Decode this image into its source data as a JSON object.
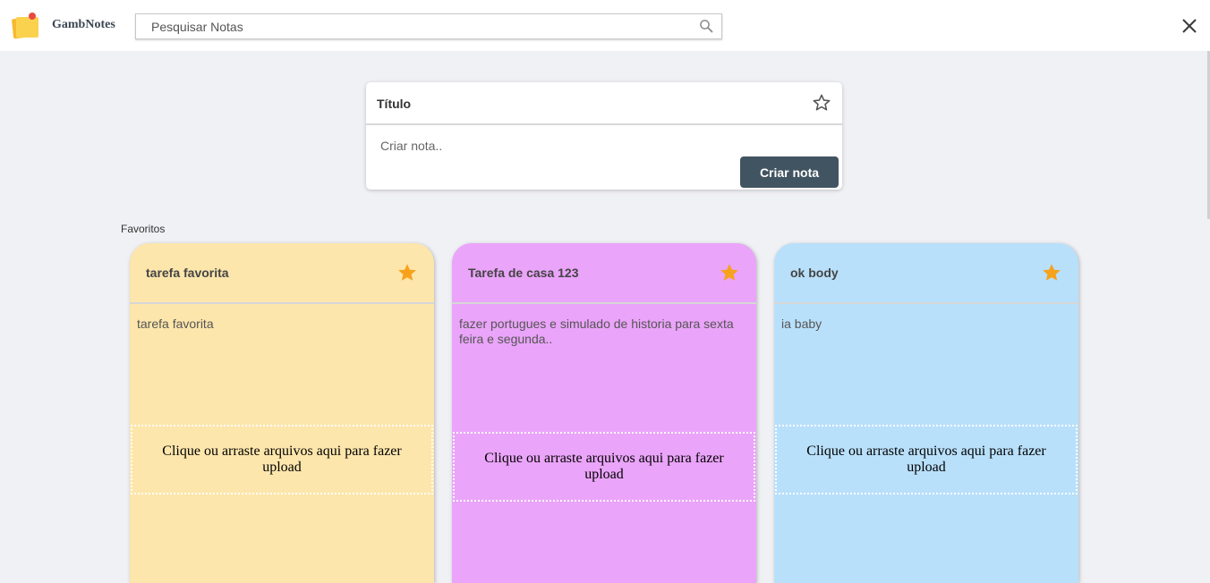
{
  "header": {
    "brand": "GambNotes",
    "search_placeholder": "Pesquisar Notas",
    "search_value": ""
  },
  "create": {
    "title": "Título",
    "body_placeholder": "Criar nota..",
    "button_label": "Criar nota"
  },
  "favorites": {
    "section_label": "Favoritos",
    "notes": [
      {
        "title": "tarefa favorita",
        "body": "tarefa favorita",
        "upload_text": "Clique ou arraste arquivos aqui para fazer upload",
        "color": "#fde6ac",
        "favorite": true
      },
      {
        "title": "Tarefa de casa 123",
        "body": "fazer portugues e simulado de historia para sexta feira e segunda..",
        "upload_text": "Clique ou arraste arquivos aqui para fazer upload",
        "color": "#eaa4f9",
        "favorite": true
      },
      {
        "title": "ok body",
        "body": "ia baby",
        "upload_text": "Clique ou arraste arquivos aqui para fazer upload",
        "color": "#b9e0fb",
        "favorite": true
      }
    ]
  },
  "colors": {
    "star_filled": "#f6a21c",
    "button_bg": "#415461"
  },
  "icons": {
    "logo": "sticky-note-logo-icon",
    "search": "search-icon",
    "close": "close-icon",
    "star_outline": "star-outline-icon",
    "star_filled": "star-filled-icon"
  }
}
